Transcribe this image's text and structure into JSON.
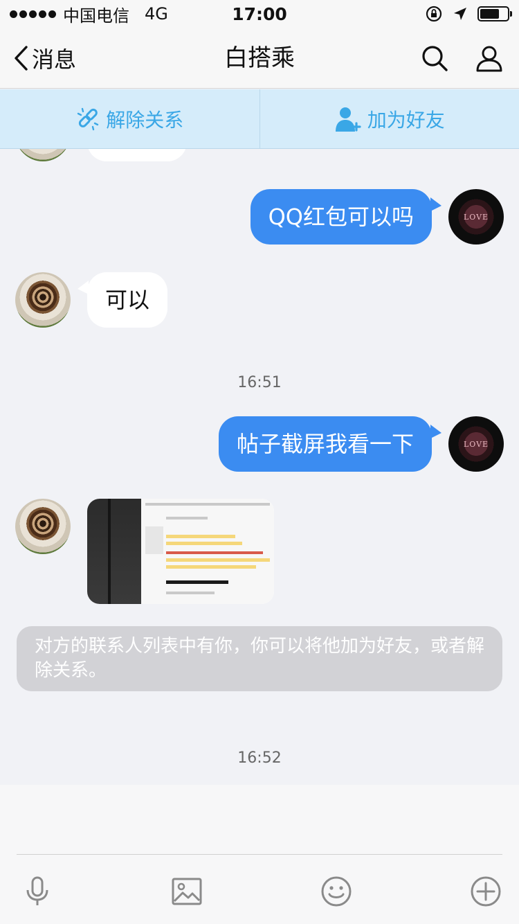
{
  "status_bar": {
    "carrier": "中国电信",
    "network": "4G",
    "time": "17:00"
  },
  "nav": {
    "back_label": "消息",
    "title": "白搭乘",
    "icons": [
      "search-icon",
      "profile-icon"
    ]
  },
  "actions": {
    "remove_label": "解除关系",
    "add_label": "加为好友",
    "accent_color": "#3aa7e6"
  },
  "messages": [
    {
      "side": "out",
      "text": "QQ红包可以吗"
    },
    {
      "side": "in",
      "text": "可以"
    },
    {
      "type": "timestamp",
      "text": "16:51"
    },
    {
      "side": "out",
      "text": "帖子截屏我看一下"
    },
    {
      "side": "in",
      "type": "image"
    }
  ],
  "system_notice": "对方的联系人列表中有你，你可以将他加为好友，或者解除关系。",
  "timestamp_2": "16:52",
  "avatar_text": "LOVE",
  "colors": {
    "outgoing_bubble": "#3b8cf1",
    "incoming_bubble": "#ffffff",
    "background": "#f1f2f6"
  },
  "toolbar": [
    "microphone-icon",
    "image-icon",
    "emoji-icon",
    "plus-icon"
  ]
}
